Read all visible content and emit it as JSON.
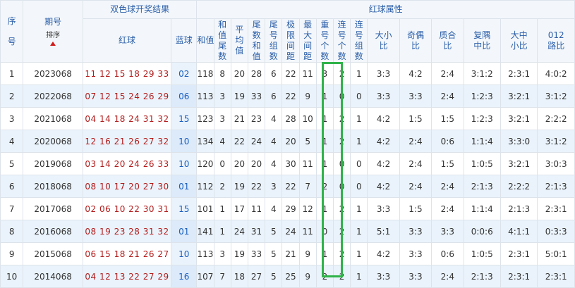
{
  "headers": {
    "seq_top": "序",
    "seq_bottom": "号",
    "issue": "期号",
    "sort": "排序",
    "group_draw": "双色球开奖结果",
    "group_red": "红球属性",
    "red": "红球",
    "blue": "蓝球",
    "sum": "和值",
    "cols": [
      "和值尾数",
      "平均值",
      "尾数和值",
      "尾号组数",
      "极限间距",
      "最大间距",
      "重号个数",
      "连号个数",
      "连号组数",
      "大小比",
      "奇偶比",
      "质合比",
      "复隅中比",
      "大中小比",
      "012路比"
    ]
  },
  "rows": [
    {
      "seq": "1",
      "issue": "2023068",
      "red": "11 12 15 18 29 33",
      "blue": "02",
      "sum": "118",
      "tail": "8",
      "avg": "20",
      "tailsum": "28",
      "tailgroups": "6",
      "limit": "22",
      "maxgap": "11",
      "repeat": "3",
      "consec": "2",
      "consecgroups": "1",
      "bigsmall": "3:3",
      "oddeven": "4:2",
      "primecomp": "2:4",
      "ratio1": "3:1:2",
      "ratio2": "2:3:1",
      "ratio3": "4:0:2"
    },
    {
      "seq": "2",
      "issue": "2022068",
      "red": "07 12 15 24 26 29",
      "blue": "06",
      "sum": "113",
      "tail": "3",
      "avg": "19",
      "tailsum": "33",
      "tailgroups": "6",
      "limit": "22",
      "maxgap": "9",
      "repeat": "1",
      "consec": "0",
      "consecgroups": "0",
      "bigsmall": "3:3",
      "oddeven": "3:3",
      "primecomp": "2:4",
      "ratio1": "1:2:3",
      "ratio2": "3:2:1",
      "ratio3": "3:1:2"
    },
    {
      "seq": "3",
      "issue": "2021068",
      "red": "04 14 18 24 31 32",
      "blue": "15",
      "sum": "123",
      "tail": "3",
      "avg": "21",
      "tailsum": "23",
      "tailgroups": "4",
      "limit": "28",
      "maxgap": "10",
      "repeat": "1",
      "consec": "2",
      "consecgroups": "1",
      "bigsmall": "4:2",
      "oddeven": "1:5",
      "primecomp": "1:5",
      "ratio1": "1:2:3",
      "ratio2": "3:2:1",
      "ratio3": "2:2:2"
    },
    {
      "seq": "4",
      "issue": "2020068",
      "red": "12 16 21 26 27 32",
      "blue": "10",
      "sum": "134",
      "tail": "4",
      "avg": "22",
      "tailsum": "24",
      "tailgroups": "4",
      "limit": "20",
      "maxgap": "5",
      "repeat": "1",
      "consec": "2",
      "consecgroups": "1",
      "bigsmall": "4:2",
      "oddeven": "2:4",
      "primecomp": "0:6",
      "ratio1": "1:1:4",
      "ratio2": "3:3:0",
      "ratio3": "3:1:2"
    },
    {
      "seq": "5",
      "issue": "2019068",
      "red": "03 14 20 24 26 33",
      "blue": "10",
      "sum": "120",
      "tail": "0",
      "avg": "20",
      "tailsum": "20",
      "tailgroups": "4",
      "limit": "30",
      "maxgap": "11",
      "repeat": "1",
      "consec": "0",
      "consecgroups": "0",
      "bigsmall": "4:2",
      "oddeven": "2:4",
      "primecomp": "1:5",
      "ratio1": "1:0:5",
      "ratio2": "3:2:1",
      "ratio3": "3:0:3"
    },
    {
      "seq": "6",
      "issue": "2018068",
      "red": "08 10 17 20 27 30",
      "blue": "01",
      "sum": "112",
      "tail": "2",
      "avg": "19",
      "tailsum": "22",
      "tailgroups": "3",
      "limit": "22",
      "maxgap": "7",
      "repeat": "2",
      "consec": "0",
      "consecgroups": "0",
      "bigsmall": "4:2",
      "oddeven": "2:4",
      "primecomp": "2:4",
      "ratio1": "2:1:3",
      "ratio2": "2:2:2",
      "ratio3": "2:1:3"
    },
    {
      "seq": "7",
      "issue": "2017068",
      "red": "02 06 10 22 30 31",
      "blue": "15",
      "sum": "101",
      "tail": "1",
      "avg": "17",
      "tailsum": "11",
      "tailgroups": "4",
      "limit": "29",
      "maxgap": "12",
      "repeat": "1",
      "consec": "2",
      "consecgroups": "1",
      "bigsmall": "3:3",
      "oddeven": "1:5",
      "primecomp": "2:4",
      "ratio1": "1:1:4",
      "ratio2": "2:1:3",
      "ratio3": "2:3:1"
    },
    {
      "seq": "8",
      "issue": "2016068",
      "red": "08 19 23 28 31 32",
      "blue": "01",
      "sum": "141",
      "tail": "1",
      "avg": "24",
      "tailsum": "31",
      "tailgroups": "5",
      "limit": "24",
      "maxgap": "11",
      "repeat": "0",
      "consec": "2",
      "consecgroups": "1",
      "bigsmall": "5:1",
      "oddeven": "3:3",
      "primecomp": "3:3",
      "ratio1": "0:0:6",
      "ratio2": "4:1:1",
      "ratio3": "0:3:3"
    },
    {
      "seq": "9",
      "issue": "2015068",
      "red": "06 15 18 21 26 27",
      "blue": "10",
      "sum": "113",
      "tail": "3",
      "avg": "19",
      "tailsum": "33",
      "tailgroups": "5",
      "limit": "21",
      "maxgap": "9",
      "repeat": "1",
      "consec": "2",
      "consecgroups": "1",
      "bigsmall": "4:2",
      "oddeven": "3:3",
      "primecomp": "0:6",
      "ratio1": "1:0:5",
      "ratio2": "2:3:1",
      "ratio3": "5:0:1"
    },
    {
      "seq": "10",
      "issue": "2014068",
      "red": "04 12 13 22 27 29",
      "blue": "16",
      "sum": "107",
      "tail": "7",
      "avg": "18",
      "tailsum": "27",
      "tailgroups": "5",
      "limit": "25",
      "maxgap": "9",
      "repeat": "2",
      "consec": "2",
      "consecgroups": "1",
      "bigsmall": "3:3",
      "oddeven": "3:3",
      "primecomp": "2:4",
      "ratio1": "2:1:3",
      "ratio2": "2:3:1",
      "ratio3": "2:3:1"
    }
  ]
}
